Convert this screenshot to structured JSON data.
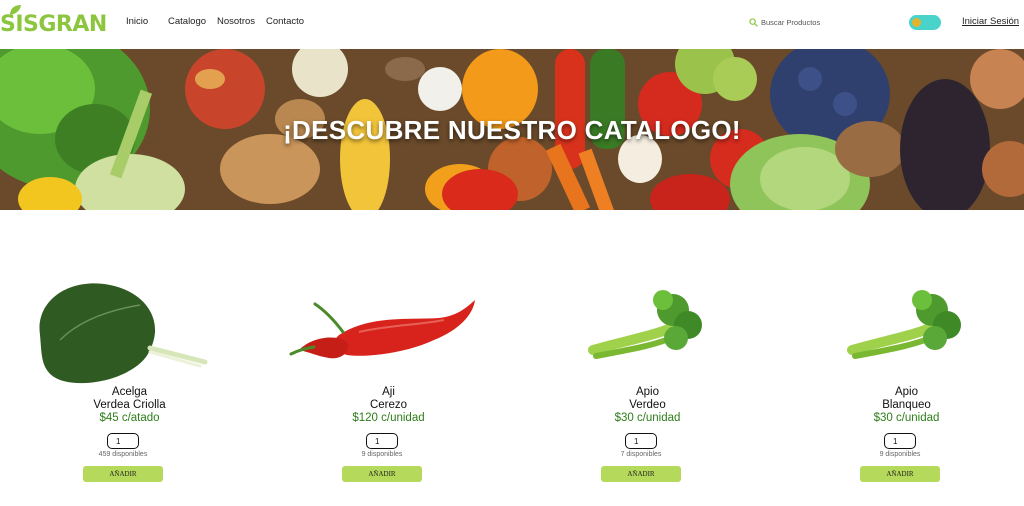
{
  "brand": {
    "logo_text": "SISGRAN",
    "accent": "#8cc63f"
  },
  "nav": {
    "items": [
      "Inicio",
      "Catalogo",
      "Nosotros",
      "Contacto"
    ]
  },
  "search": {
    "placeholder": "Buscar Productos",
    "icon": "search-icon"
  },
  "theme_toggle": {
    "track_color": "#49d3cb",
    "knob_color": "#e4b32c"
  },
  "login": {
    "label": "Iniciar Sesión"
  },
  "hero": {
    "title": "¡DESCUBRE NUESTRO CATALOGO!"
  },
  "products": [
    {
      "name": "Acelga",
      "variety": "Verdea Criolla",
      "price": "$45 c/atado",
      "qty": "1",
      "available": "459 disponibles",
      "button": "AÑADIR",
      "image": "chard-image"
    },
    {
      "name": "Aji",
      "variety": "Cerezo",
      "price": "$120 c/unidad",
      "qty": "1",
      "available": "9 disponibles",
      "button": "AÑADIR",
      "image": "chili-pepper-image"
    },
    {
      "name": "Apio",
      "variety": "Verdeo",
      "price": "$30 c/unidad",
      "qty": "1",
      "available": "7 disponibles",
      "button": "AÑADIR",
      "image": "celery-image"
    },
    {
      "name": "Apio",
      "variety": "Blanqueo",
      "price": "$30 c/unidad",
      "qty": "1",
      "available": "9 disponibles",
      "button": "AÑADIR",
      "image": "celery-image"
    }
  ],
  "colors": {
    "price": "#2e7d1a",
    "button": "#b5da5b"
  }
}
